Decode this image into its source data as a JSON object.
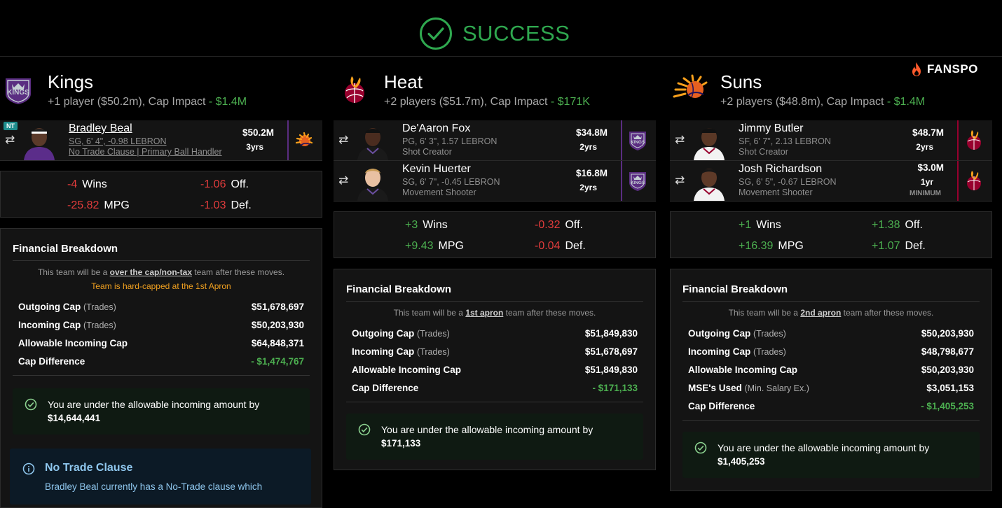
{
  "header": {
    "status": "SUCCESS",
    "brand": "FANSPO"
  },
  "colors": {
    "success": "#2fa84f",
    "positive": "#4caf50",
    "negative": "#e23c3c",
    "kings": "#5a2d81",
    "heat": "#98002e",
    "suns": "#e56020",
    "warning": "#f0a020",
    "info": "#8fc7ee"
  },
  "teams": [
    {
      "name": "Kings",
      "summary_prefix": "+1 player ($50.2m), Cap Impact",
      "summary_impact": " - $1.4M",
      "players": [
        {
          "name": "Bradley Beal",
          "badge": "NT",
          "line1": "SG, 6' 4\", -0.98 LEBRON",
          "line2": "No Trade Clause | Primary Ball Handler",
          "salary": "$50.2M",
          "years": "3yrs",
          "from_logo": "suns-logo"
        }
      ],
      "stats": {
        "wins": "-4",
        "wins_label": "Wins",
        "mpg": "-25.82",
        "mpg_label": "MPG",
        "off": "-1.06",
        "off_label": "Off.",
        "def": "-1.03",
        "def_label": "Def."
      },
      "financial": {
        "title": "Financial Breakdown",
        "note_pre": "This team will be a ",
        "note_status": "over the cap/non-tax",
        "note_post": " team after these moves.",
        "warning": "Team is hard-capped at the 1st Apron",
        "rows": [
          {
            "label": "Outgoing Cap",
            "sub": "(Trades)",
            "value": "$51,678,697"
          },
          {
            "label": "Incoming Cap",
            "sub": "(Trades)",
            "value": "$50,203,930"
          },
          {
            "label": "Allowable Incoming Cap",
            "sub": "",
            "value": "$64,848,371"
          },
          {
            "label": "Cap Difference",
            "sub": "",
            "value": "- $1,474,767"
          }
        ],
        "ok_text": "You are under the allowable incoming amount by",
        "ok_amount": "$14,644,441"
      },
      "ntc": {
        "title": "No Trade Clause",
        "body": "Bradley Beal currently has a No-Trade clause which"
      }
    },
    {
      "name": "Heat",
      "summary_prefix": "+2 players ($51.7m), Cap Impact",
      "summary_impact": " - $171K",
      "players": [
        {
          "name": "De'Aaron Fox",
          "line1": "PG, 6' 3\", 1.57 LEBRON",
          "line2": "Shot Creator",
          "salary": "$34.8M",
          "years": "2yrs",
          "from_logo": "kings-logo"
        },
        {
          "name": "Kevin Huerter",
          "line1": "SG, 6' 7\", -0.45 LEBRON",
          "line2": "Movement Shooter",
          "salary": "$16.8M",
          "years": "2yrs",
          "from_logo": "kings-logo"
        }
      ],
      "stats": {
        "wins": "+3",
        "wins_label": "Wins",
        "mpg": "+9.43",
        "mpg_label": "MPG",
        "off": "-0.32",
        "off_label": "Off.",
        "def": "-0.04",
        "def_label": "Def."
      },
      "financial": {
        "title": "Financial Breakdown",
        "note_pre": "This team will be a ",
        "note_status": "1st apron",
        "note_post": " team after these moves.",
        "rows": [
          {
            "label": "Outgoing Cap",
            "sub": "(Trades)",
            "value": "$51,849,830"
          },
          {
            "label": "Incoming Cap",
            "sub": "(Trades)",
            "value": "$51,678,697"
          },
          {
            "label": "Allowable Incoming Cap",
            "sub": "",
            "value": "$51,849,830"
          },
          {
            "label": "Cap Difference",
            "sub": "",
            "value": "- $171,133"
          }
        ],
        "ok_text": "You are under the allowable incoming amount by",
        "ok_amount": "$171,133"
      }
    },
    {
      "name": "Suns",
      "summary_prefix": "+2 players ($48.8m), Cap Impact",
      "summary_impact": " - $1.4M",
      "players": [
        {
          "name": "Jimmy Butler",
          "line1": "SF, 6' 7\", 2.13 LEBRON",
          "line2": "Shot Creator",
          "salary": "$48.7M",
          "years": "2yrs",
          "from_logo": "heat-logo"
        },
        {
          "name": "Josh Richardson",
          "line1": "SG, 6' 5\", -0.67 LEBRON",
          "line2": "Movement Shooter",
          "salary": "$3.0M",
          "years": "1yr",
          "extra": "MINIMUM",
          "from_logo": "heat-logo"
        }
      ],
      "stats": {
        "wins": "+1",
        "wins_label": "Wins",
        "mpg": "+16.39",
        "mpg_label": "MPG",
        "off": "+1.38",
        "off_label": "Off.",
        "def": "+1.07",
        "def_label": "Def."
      },
      "financial": {
        "title": "Financial Breakdown",
        "note_pre": "This team will be a ",
        "note_status": "2nd apron",
        "note_post": " team after these moves.",
        "rows": [
          {
            "label": "Outgoing Cap",
            "sub": "(Trades)",
            "value": "$50,203,930"
          },
          {
            "label": "Incoming Cap",
            "sub": "(Trades)",
            "value": "$48,798,677"
          },
          {
            "label": "Allowable Incoming Cap",
            "sub": "",
            "value": "$50,203,930"
          },
          {
            "label": "MSE's Used",
            "sub": "(Min. Salary Ex.)",
            "value": "$3,051,153"
          },
          {
            "label": "Cap Difference",
            "sub": "",
            "value": "- $1,405,253"
          }
        ],
        "ok_text": "You are under the allowable incoming amount by",
        "ok_amount": "$1,405,253"
      }
    }
  ]
}
